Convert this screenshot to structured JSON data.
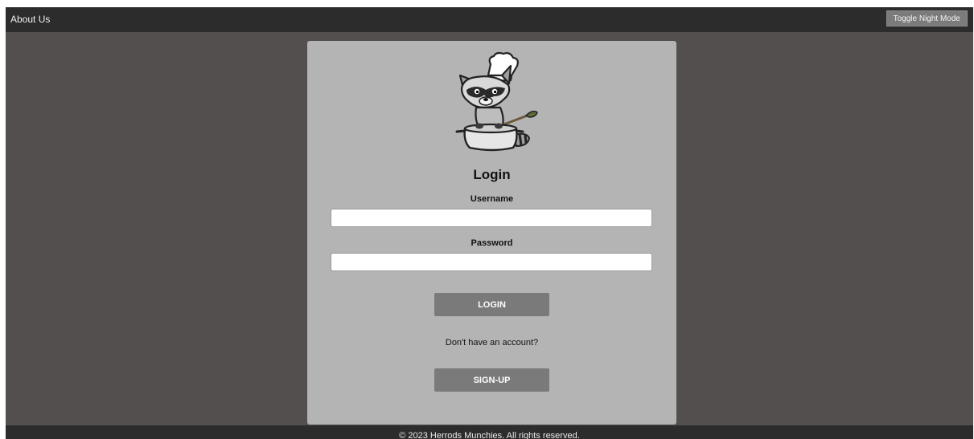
{
  "nav": {
    "about_label": "About Us",
    "toggle_label": "Toggle Night Mode"
  },
  "login": {
    "title": "Login",
    "username_label": "Username",
    "username_value": "",
    "password_label": "Password",
    "password_value": "",
    "login_button": "LOGIN",
    "no_account_text": "Don't have an account?",
    "signup_button": "SIGN-UP"
  },
  "footer": {
    "copyright": "© 2023 Herrods Munchies. All rights reserved."
  },
  "colors": {
    "page_bg": "#534f4f",
    "bar_bg": "#2c2c2c",
    "card_bg": "#b4b4b4",
    "button_bg": "#7a7a7a"
  },
  "logo": {
    "icon": "raccoon-chef-logo"
  }
}
